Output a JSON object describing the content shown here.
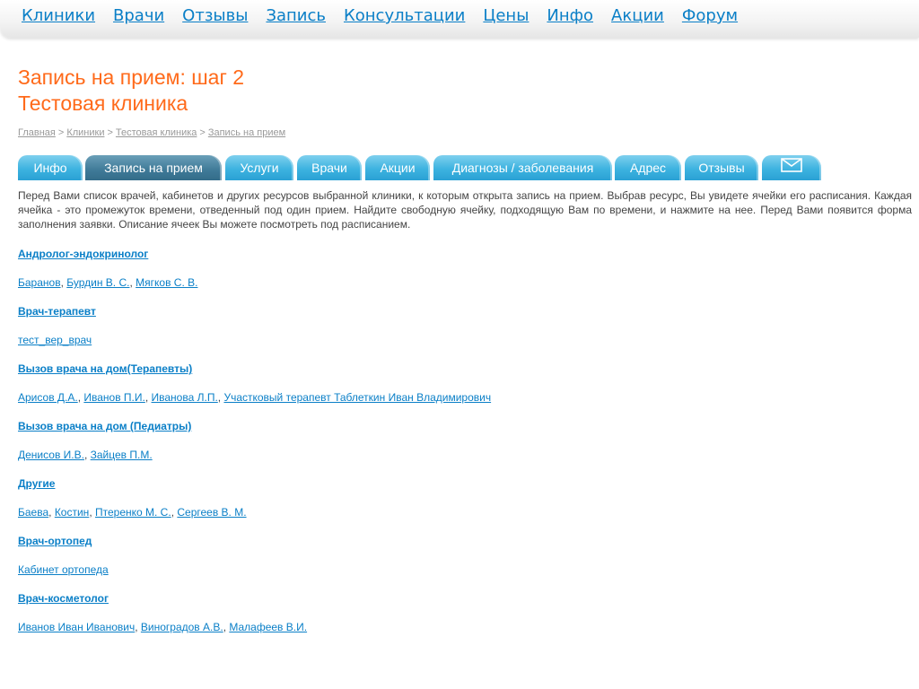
{
  "nav": [
    "Клиники",
    "Врачи",
    "Отзывы",
    "Запись",
    "Консультации",
    "Цены",
    "Инфо",
    "Акции",
    "Форум"
  ],
  "title": {
    "line1": "Запись на прием: шаг 2",
    "line2": "Тестовая клиника"
  },
  "breadcrumb": [
    "Главная",
    "Клиники",
    "Тестовая клиника",
    "Запись на прием"
  ],
  "tabs": [
    "Инфо",
    "Запись на прием",
    "Услуги",
    "Врачи",
    "Акции",
    "Диагнозы / заболевания",
    "Адрес",
    "Отзывы"
  ],
  "active_tab": "Запись на прием",
  "mail_tab_icon": "envelope-icon",
  "intro": "Перед Вами список врачей, кабинетов и других ресурсов выбранной клиники, к которым открыта запись на прием. Выбрав ресурс, Вы увидете ячейки его расписания. Каждая ячейка - это промежуток времени, отведенный под один прием. Найдите свободную ячейку, подходящую Вам по времени, и нажмите на нее. Перед Вами появится форма заполнения заявки. Описание ячеек Вы можете посмотреть под расписанием.",
  "groups": [
    {
      "title": "Андролог-эндокринолог",
      "items": [
        "Баранов",
        "Бурдин В. С.",
        "Мягков С. В."
      ]
    },
    {
      "title": "Врач-терапевт",
      "items": [
        "тест_вер_врач"
      ]
    },
    {
      "title": "Вызов врача на дом(Терапевты)",
      "items": [
        "Арисов Д.А.",
        "Иванов П.И.",
        "Иванова Л.П.",
        "Участковый терапевт Таблеткин Иван Владимирович"
      ]
    },
    {
      "title": "Вызов врача на дом (Педиатры)",
      "items": [
        "Денисов И.В.",
        "Зайцев П.М."
      ]
    },
    {
      "title": "Другие",
      "items": [
        "Баева",
        "Костин",
        "Птеренко М. С.",
        "Сергеев В. М."
      ]
    },
    {
      "title": "Врач-ортопед",
      "items": [
        "Кабинет ортопеда"
      ]
    },
    {
      "title": "Врач-косметолог",
      "items": [
        "Иванов Иван Иванович",
        "Виноградов А.В.",
        "Малафеев В.И."
      ]
    }
  ],
  "colors": {
    "link": "#0a7fc7",
    "title": "#ff6a1a",
    "tab": "#3db3e0",
    "tab_active": "#3f7a98"
  }
}
